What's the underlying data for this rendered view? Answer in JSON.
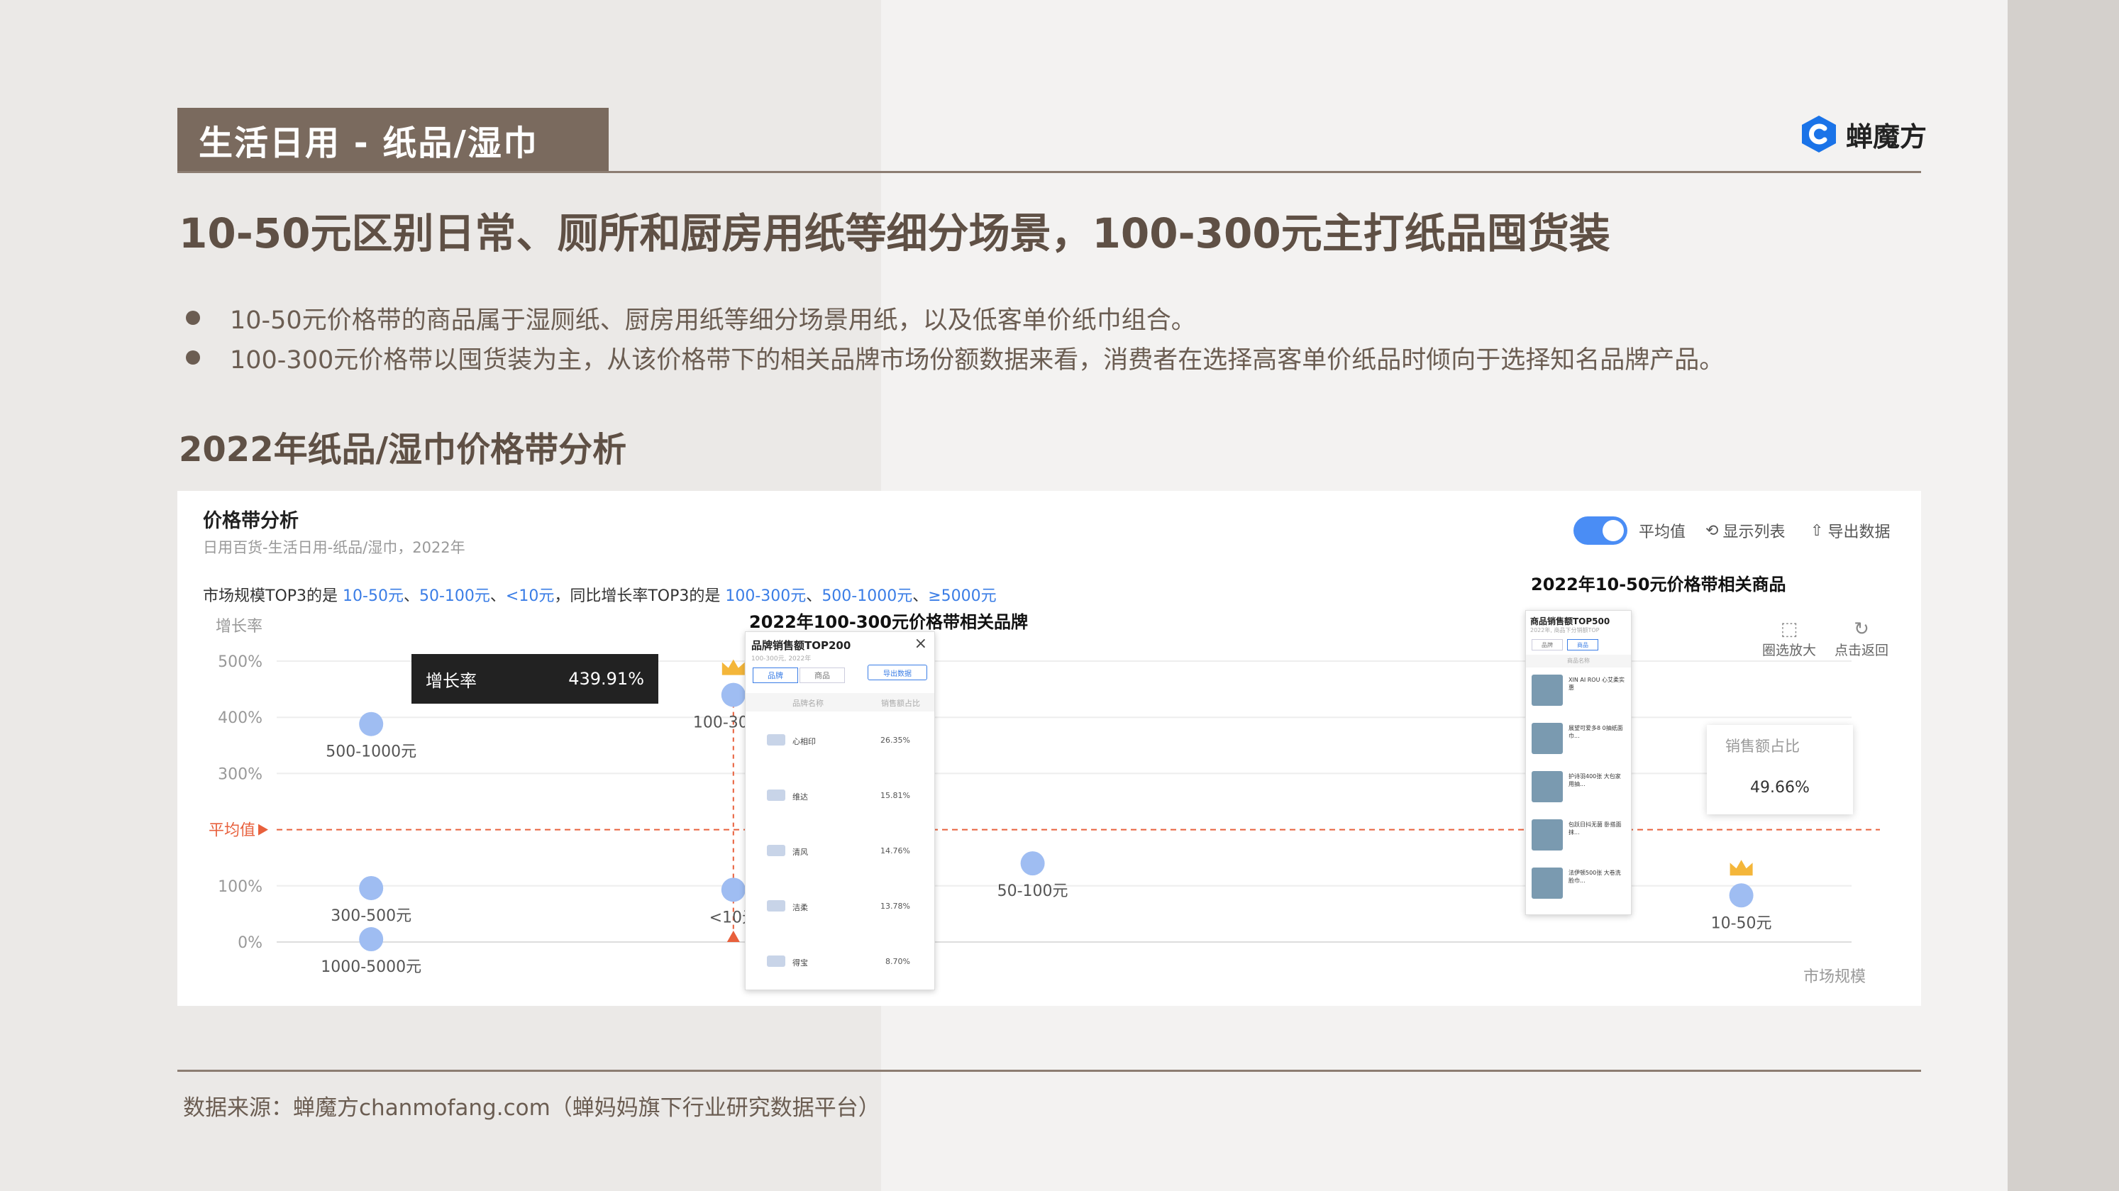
{
  "section_tag": "生活日用 - 纸品/湿巾",
  "brand_name": "蝉魔方",
  "headline": "10-50元区别日常、厕所和厨房用纸等细分场景，100-300元主打纸品囤货装",
  "bullets": [
    "10-50元价格带的商品属于湿厕纸、厨房用纸等细分场景用纸，以及低客单价纸巾组合。",
    "100-300元价格带以囤货装为主，从该价格带下的相关品牌市场份额数据来看，消费者在选择高客单价纸品时倾向于选择知名品牌产品。"
  ],
  "sub_heading": "2022年纸品/湿巾价格带分析",
  "panel": {
    "title": "价格带分析",
    "subtitle": "日用百货-生活日用-纸品/湿巾，2022年",
    "toggle_label": "平均值",
    "show_list_label": "显示列表",
    "export_label": "导出数据",
    "summary_prefix": "市场规模TOP3的是 ",
    "summary_scale": [
      "10-50元",
      "50-100元",
      "<10元"
    ],
    "summary_mid": "，同比增长率TOP3的是 ",
    "summary_growth": [
      "100-300元",
      "500-1000元",
      "≥5000元"
    ],
    "zoom_label": "圈选放大",
    "back_label": "点击返回"
  },
  "tooltip": {
    "label": "增长率",
    "value": "439.91%"
  },
  "callouts": {
    "brands_title": "2022年100-300元价格带相关品牌",
    "products_title": "2022年10-50元价格带相关商品"
  },
  "brand_popup": {
    "title": "品牌销售额TOP200",
    "subtitle": "100-300元, 2022年",
    "tab_brand": "品牌",
    "tab_product": "商品",
    "export": "导出数据",
    "col_name": "品牌名称",
    "col_share": "销售额占比",
    "rows": [
      {
        "name": "心相印",
        "share": "26.35%"
      },
      {
        "name": "维达",
        "share": "15.81%"
      },
      {
        "name": "清风",
        "share": "14.76%"
      },
      {
        "name": "洁柔",
        "share": "13.78%"
      },
      {
        "name": "得宝",
        "share": "8.70%"
      }
    ]
  },
  "product_popup": {
    "title": "商品销售额TOP500",
    "subtitle": "2022年, 商品下分销额TOP",
    "tab_brand": "品牌",
    "tab_product": "商品",
    "col_name": "商品名称",
    "rows": [
      "XIN AI ROU 心艾柔实惠",
      "展望可爱多8 0抽纸面巾...",
      "护诗羽400张 大包家用抽...",
      "包跃日抖无菌 卧搭面抹...",
      "法伊顿500张 大卷洗脸巾..."
    ]
  },
  "sales_card": {
    "label": "销售额占比",
    "value": "49.66%"
  },
  "chart_data": {
    "type": "scatter",
    "xlabel": "市场规模",
    "ylabel": "增长率",
    "y_ticks": [
      "0%",
      "100%",
      "300%",
      "400%",
      "500%"
    ],
    "y_tick_values": [
      0,
      100,
      300,
      400,
      500
    ],
    "ylim": [
      0,
      500
    ],
    "average_label": "平均值",
    "average_growth": 200,
    "x_scale": "relative (unlabeled)",
    "points": [
      {
        "label": "500-1000元",
        "x": 0.06,
        "y": 388
      },
      {
        "label": "300-500元",
        "x": 0.06,
        "y": 96
      },
      {
        "label": "1000-5000元",
        "x": 0.06,
        "y": 5
      },
      {
        "label": "100-300元",
        "x": 0.29,
        "y": 439.91
      },
      {
        "label": "<10元",
        "x": 0.29,
        "y": 93
      },
      {
        "label": "50-100元",
        "x": 0.48,
        "y": 140
      },
      {
        "label": "10-50元",
        "x": 0.93,
        "y": 83
      }
    ],
    "crowned": [
      "100-300元",
      "10-50元"
    ],
    "grid": true
  },
  "footer": "数据来源：蝉魔方chanmofang.com（蝉妈妈旗下行业研究数据平台）",
  "colors": {
    "tag_bg": "#7a6a5e",
    "heading": "#5f5045",
    "point": "#9fbdf2",
    "average_line": "#e8603c",
    "highlight": "#3a7de6"
  }
}
